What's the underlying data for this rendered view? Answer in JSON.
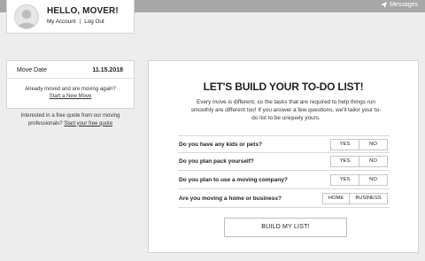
{
  "header": {
    "messages_label": "Messages",
    "messages_icon": "paper-plane-icon"
  },
  "profile": {
    "greeting": "HELLO, MOVER!",
    "my_account": "My Account",
    "separator": "|",
    "log_out": "Log Out",
    "avatar_icon": "user-silhouette-icon"
  },
  "move": {
    "label": "Move Date",
    "date": "11.15.2018",
    "moved_text": "Already moved and are moving again?",
    "new_move_link": "Start a New Move"
  },
  "quote": {
    "text": "Interested in a free quote from our moving professionals?",
    "link": "Start your free quote"
  },
  "todo": {
    "title": "LET'S BUILD YOUR TO-DO LIST!",
    "description": "Every move is different, so the tasks that are required to help things run smoothly are different too! If you answer a few questions, we'll tailor your to-do list to be uniquely yours.",
    "questions": [
      {
        "label": "Do you have any kids or pets?",
        "options": [
          "YES",
          "NO"
        ]
      },
      {
        "label": "Do you plan pack yourself?",
        "options": [
          "YES",
          "NO"
        ]
      },
      {
        "label": "Do you plan to use a moving company?",
        "options": [
          "YES",
          "NO"
        ]
      },
      {
        "label": "Are you moving a home or business?",
        "options": [
          "HOME",
          "BUSINESS"
        ]
      }
    ],
    "build_button": "BUILD MY LIST!"
  },
  "colors": {
    "topbar": "#a7a7a7",
    "background": "#ededed",
    "card": "#ffffff"
  }
}
